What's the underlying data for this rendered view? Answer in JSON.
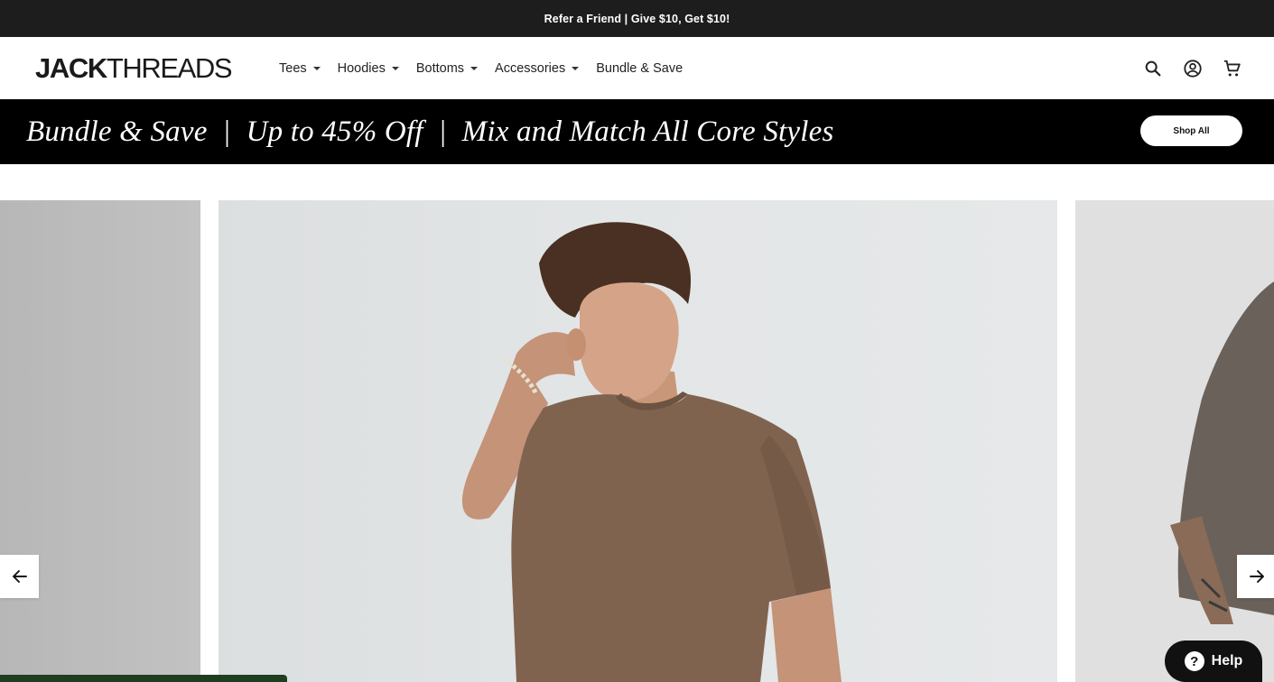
{
  "announcement": {
    "text": "Refer a Friend | Give $10, Get $10!"
  },
  "header": {
    "logo_bold": "JACK",
    "logo_light": "THREADS",
    "nav": [
      {
        "label": "Tees",
        "has_dropdown": true
      },
      {
        "label": "Hoodies",
        "has_dropdown": true
      },
      {
        "label": "Bottoms",
        "has_dropdown": true
      },
      {
        "label": "Accessories",
        "has_dropdown": true
      },
      {
        "label": "Bundle & Save",
        "has_dropdown": false
      }
    ],
    "icons": [
      "search-icon",
      "account-icon",
      "cart-icon"
    ]
  },
  "promo": {
    "text": "Bundle & Save  |  Up to 45% Off  |  Mix and Match All Core Styles",
    "button_label": "Shop All"
  },
  "carousel": {
    "prev_icon": "arrow-left-icon",
    "next_icon": "arrow-right-icon"
  },
  "help": {
    "label": "Help",
    "icon": "question-icon"
  },
  "colors": {
    "announcement_bg": "#1d1d1d",
    "promo_bg": "#000000",
    "shirt_brown": "#7f634f",
    "help_bg": "#111111"
  }
}
